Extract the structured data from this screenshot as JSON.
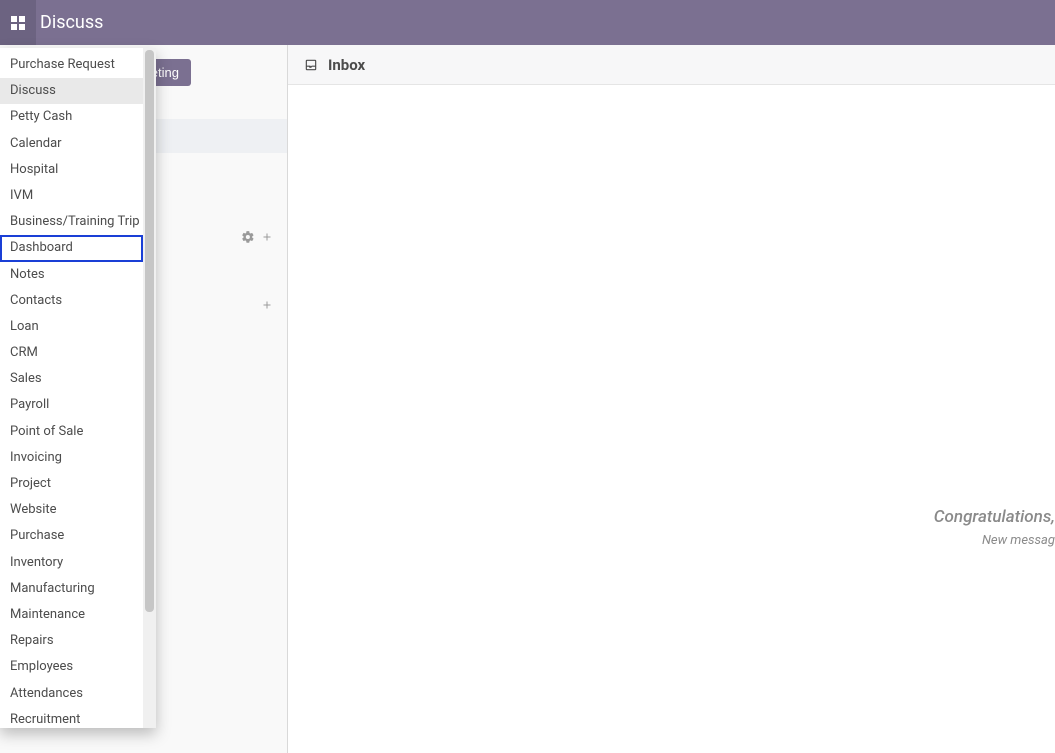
{
  "header": {
    "title": "Discuss"
  },
  "discuss_sidebar": {
    "meeting_button": "eting"
  },
  "main": {
    "inbox_title": "Inbox",
    "empty_heading": "Congratulations, ",
    "empty_sub": "New messag"
  },
  "app_menu": {
    "items": [
      {
        "label": "Purchase Request"
      },
      {
        "label": "Discuss",
        "active": true
      },
      {
        "label": "Petty Cash"
      },
      {
        "label": "Calendar"
      },
      {
        "label": "Hospital"
      },
      {
        "label": "IVM"
      },
      {
        "label": "Business/Training Trip"
      },
      {
        "label": "Dashboard",
        "highlight": true
      },
      {
        "label": "Notes"
      },
      {
        "label": "Contacts"
      },
      {
        "label": "Loan"
      },
      {
        "label": "CRM"
      },
      {
        "label": "Sales"
      },
      {
        "label": "Payroll"
      },
      {
        "label": "Point of Sale"
      },
      {
        "label": "Invoicing"
      },
      {
        "label": "Project"
      },
      {
        "label": "Website"
      },
      {
        "label": "Purchase"
      },
      {
        "label": "Inventory"
      },
      {
        "label": "Manufacturing"
      },
      {
        "label": "Maintenance"
      },
      {
        "label": "Repairs"
      },
      {
        "label": "Employees"
      },
      {
        "label": "Attendances"
      },
      {
        "label": "Recruitment"
      }
    ]
  }
}
